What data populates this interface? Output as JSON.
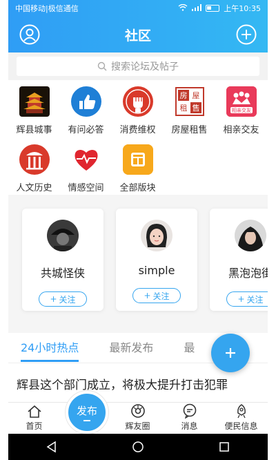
{
  "status": {
    "carrier": "中国移动|极信通信",
    "time": "上午10:35"
  },
  "header": {
    "title": "社区"
  },
  "search": {
    "placeholder": "搜索论坛及帖子"
  },
  "forums": [
    {
      "label": "辉县城事",
      "icon": "pagoda-icon"
    },
    {
      "label": "有问必答",
      "icon": "thumbs-up-icon"
    },
    {
      "label": "消费维权",
      "icon": "fist-icon"
    },
    {
      "label": "房屋租售",
      "icon": "house-rent-icon"
    },
    {
      "label": "相亲交友",
      "icon": "dating-icon"
    },
    {
      "label": "人文历史",
      "icon": "culture-icon"
    },
    {
      "label": "情感空间",
      "icon": "heart-pulse-icon"
    },
    {
      "label": "全部版块",
      "icon": "all-sections-icon"
    }
  ],
  "users": [
    {
      "name": "共城怪侠",
      "follow": "关注"
    },
    {
      "name": "simple",
      "follow": "关注"
    },
    {
      "name": "黑泡泡街",
      "follow": "关注"
    }
  ],
  "tabs": [
    "24小时热点",
    "最新发布",
    "最"
  ],
  "post": {
    "title": "辉县这个部门成立，将极大提升打击犯罪"
  },
  "publish_label": "发布",
  "nav": [
    "首页",
    "辉友圈",
    "消息",
    "便民信息"
  ],
  "colors": {
    "brand": "#2f9df5",
    "accent": "#35a5ef"
  }
}
